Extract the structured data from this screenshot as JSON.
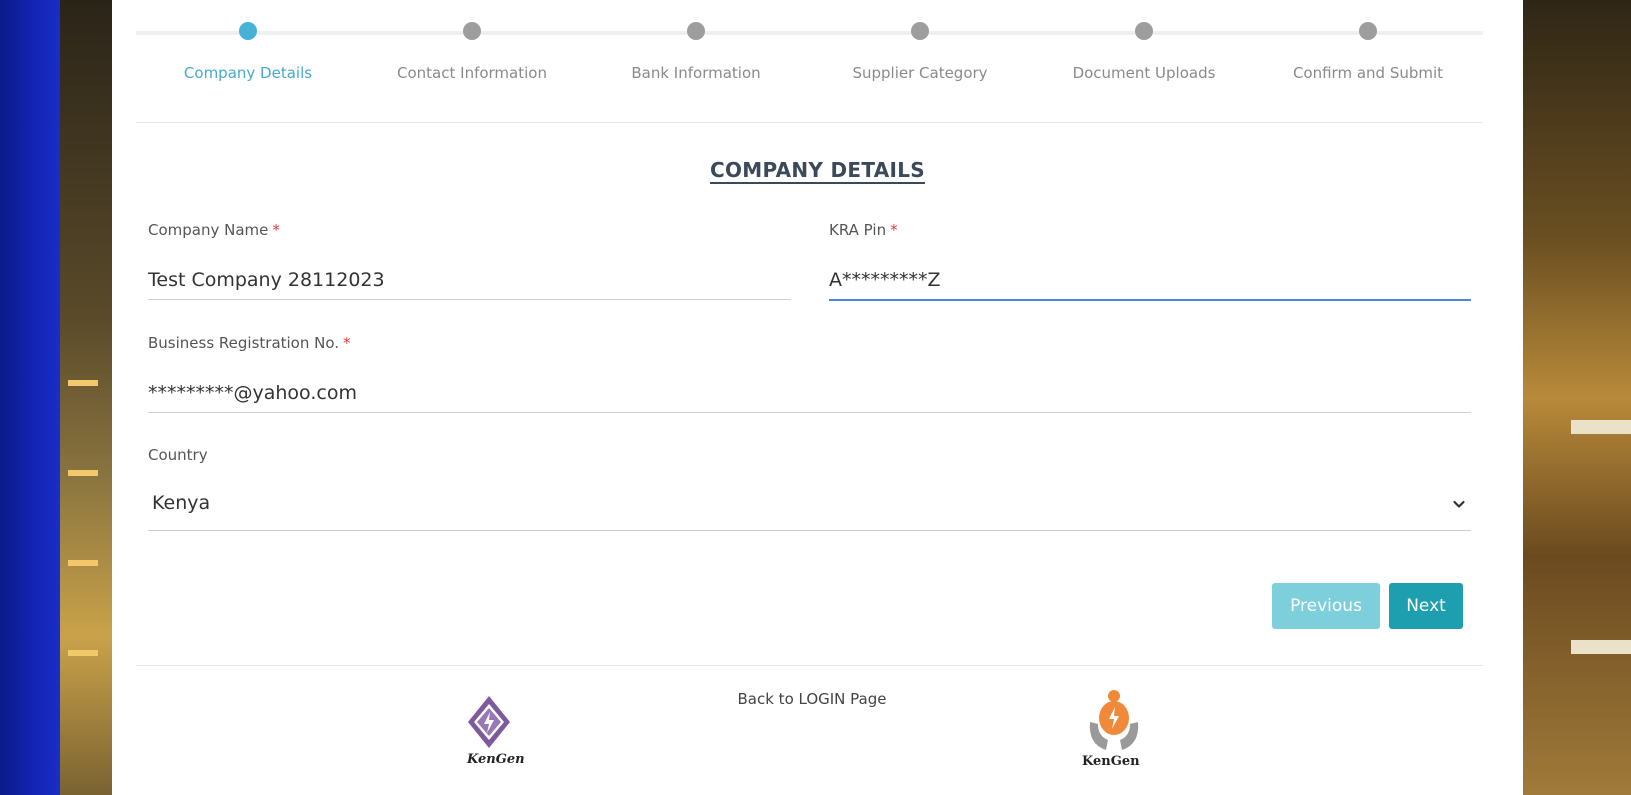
{
  "stepper": {
    "steps": [
      {
        "label": "Company Details",
        "active": true
      },
      {
        "label": "Contact Information",
        "active": false
      },
      {
        "label": "Bank Information",
        "active": false
      },
      {
        "label": "Supplier Category",
        "active": false
      },
      {
        "label": "Document Uploads",
        "active": false
      },
      {
        "label": "Confirm and Submit",
        "active": false
      }
    ],
    "active_color": "#46b3d6",
    "inactive_color": "#9e9e9e"
  },
  "form": {
    "title": "COMPANY DETAILS",
    "required_mark": "*",
    "company_name": {
      "label": "Company Name",
      "value": "Test Company 28112023"
    },
    "kra_pin": {
      "label": "KRA Pin",
      "value": "A*********Z"
    },
    "business_reg": {
      "label": "Business Registration No.",
      "value": "*********@yahoo.com"
    },
    "country": {
      "label": "Country",
      "value": "Kenya"
    }
  },
  "buttons": {
    "previous": "Previous",
    "next": "Next"
  },
  "footer": {
    "back_link": "Back to LOGIN Page",
    "logo_left_text": "KenGen",
    "logo_right_text": "KenGen"
  },
  "colors": {
    "accent": "#1e9fb0",
    "accent_light": "#7ccfdb",
    "focus": "#4b87d6",
    "required": "#e53935"
  }
}
